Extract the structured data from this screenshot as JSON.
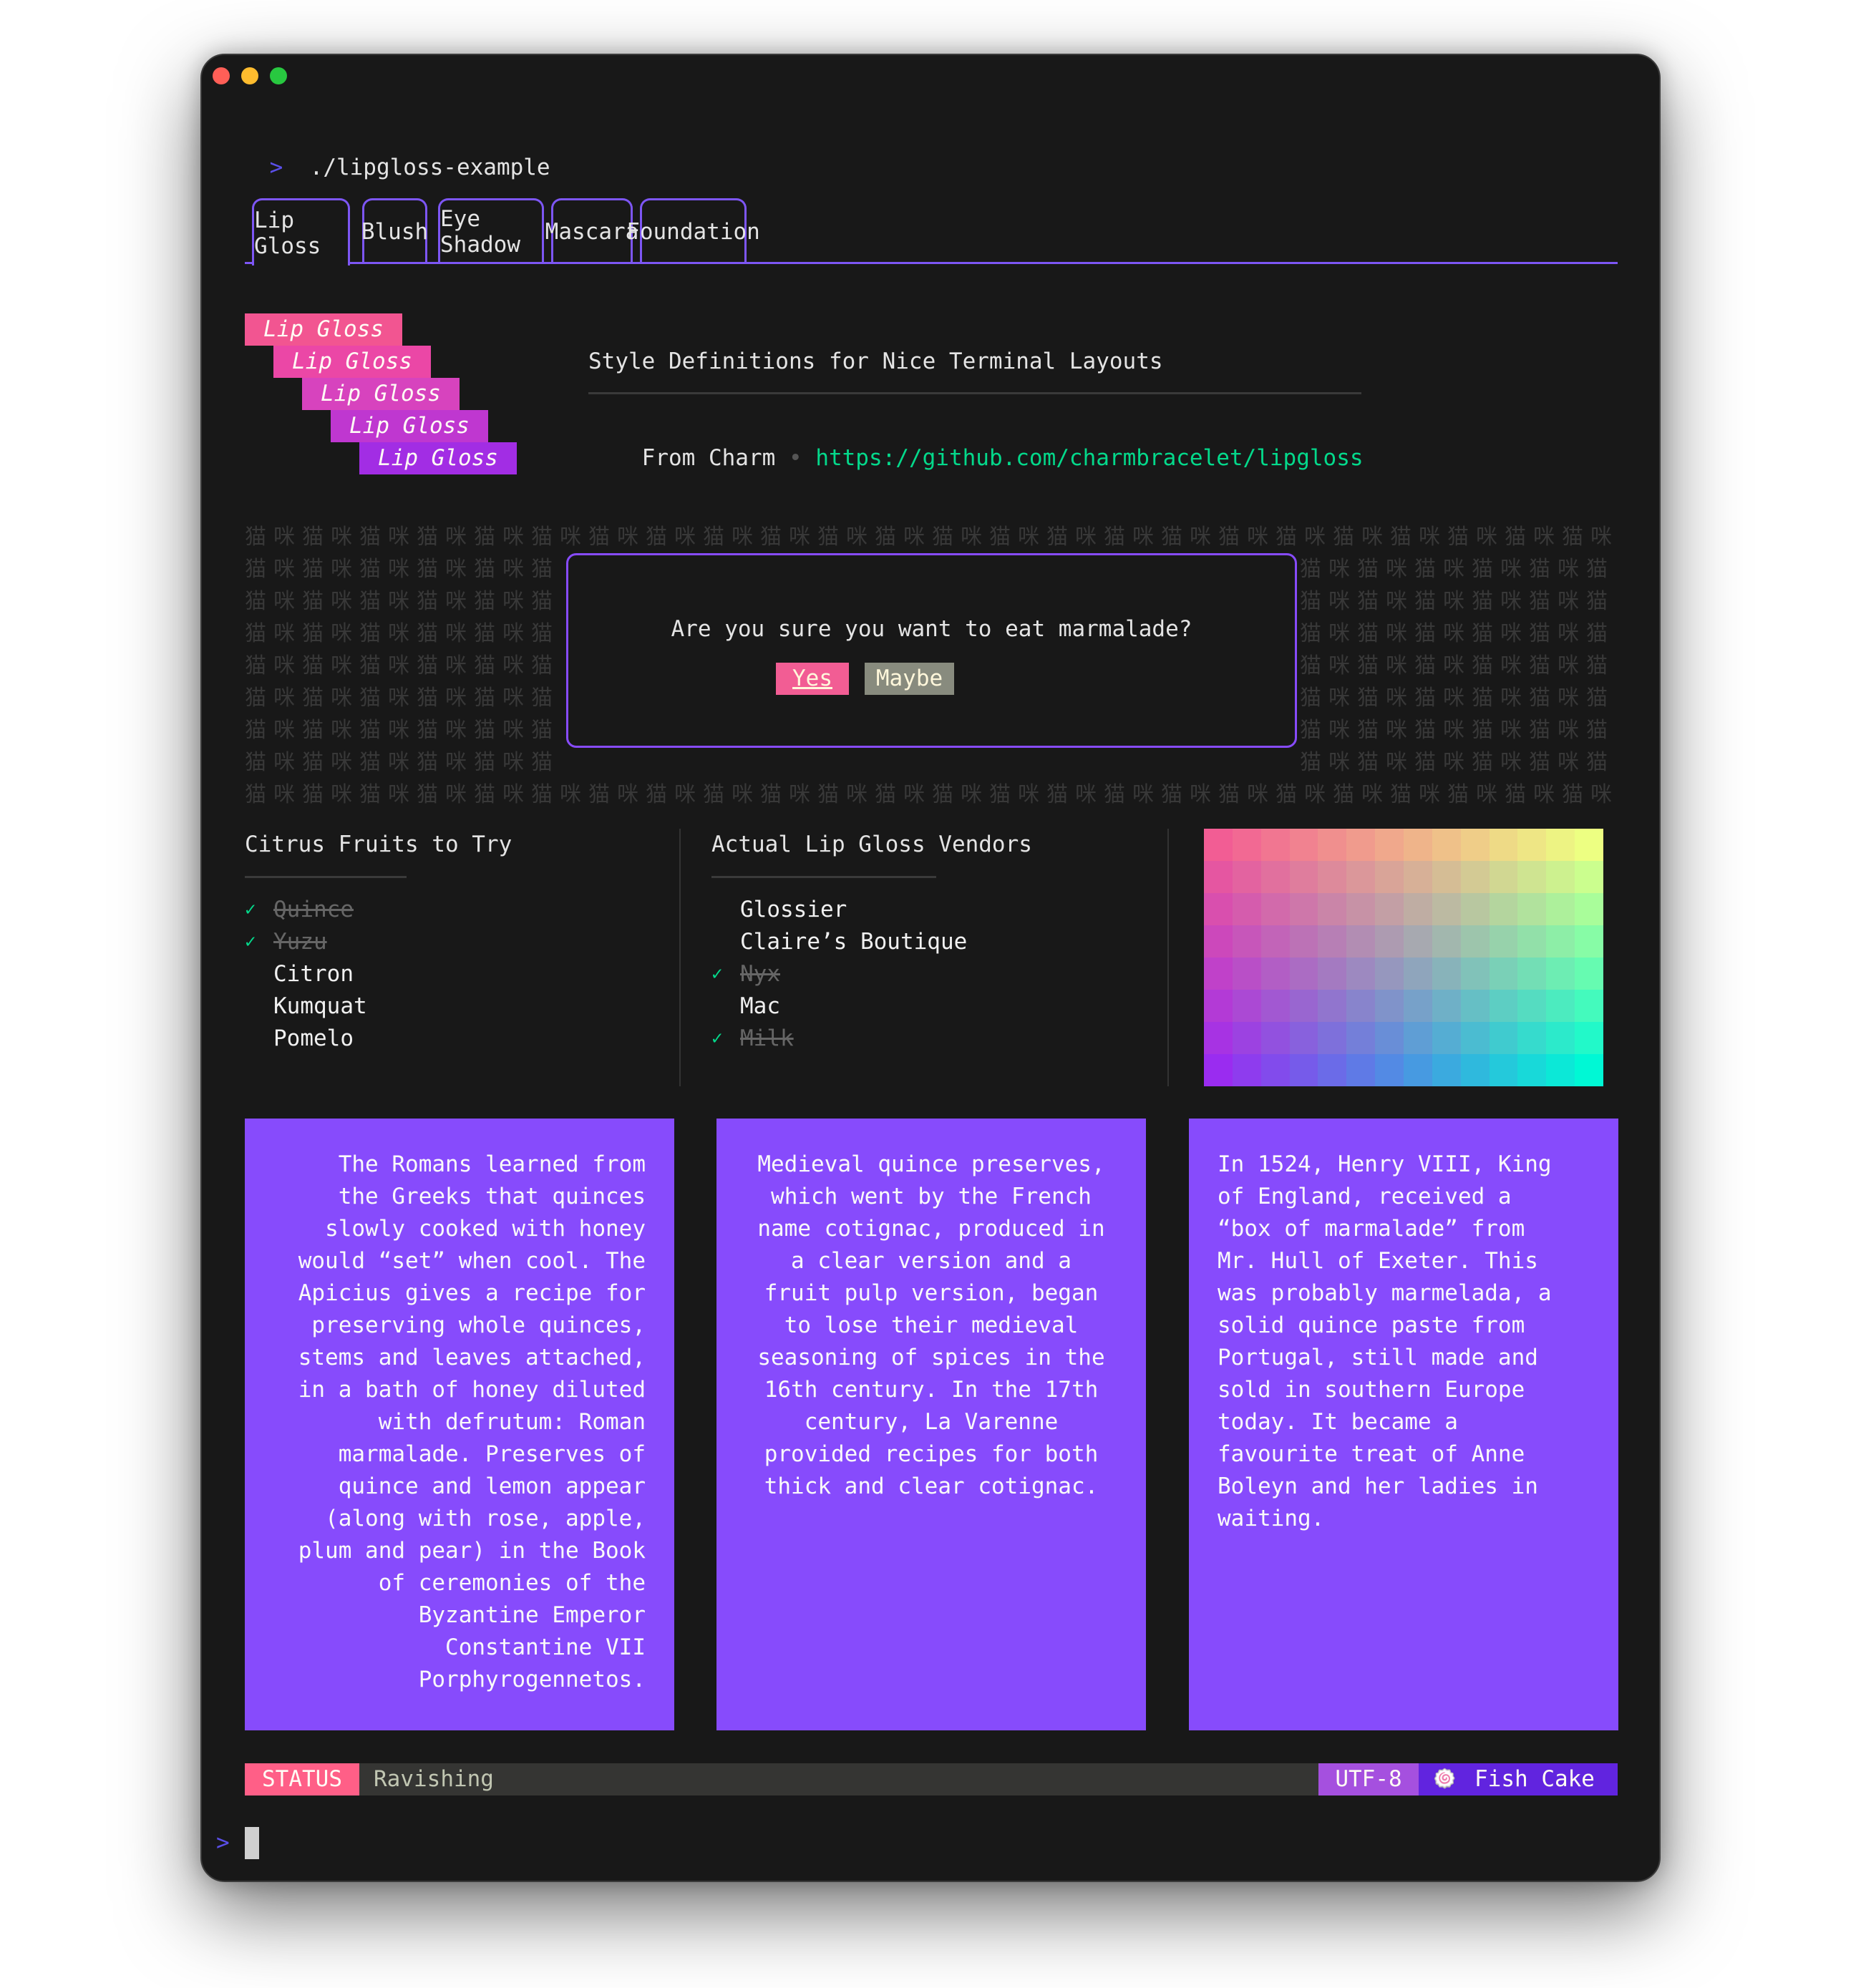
{
  "window": {
    "traffic_lights": [
      {
        "name": "close",
        "color": "#FF5F57"
      },
      {
        "name": "minimize",
        "color": "#FEBC2E"
      },
      {
        "name": "zoom",
        "color": "#28C840"
      }
    ]
  },
  "terminal": {
    "prompt_symbol": ">",
    "command": "./lipgloss-example"
  },
  "tabs": [
    {
      "label": "Lip Gloss",
      "active": true
    },
    {
      "label": "Blush",
      "active": false
    },
    {
      "label": "Eye Shadow",
      "active": false
    },
    {
      "label": "Mascara",
      "active": false
    },
    {
      "label": "Foundation",
      "active": false
    }
  ],
  "title_block": {
    "stack_label": "Lip Gloss",
    "stack_colors": [
      "#F25591",
      "#EB47A6",
      "#D743BE",
      "#BF37D0",
      "#A22DE4"
    ],
    "description": "Style Definitions for Nice Terminal Layouts",
    "from_label": "From Charm",
    "separator": "•",
    "url": "https://github.com/charmbracelet/lipgloss"
  },
  "background_pattern": {
    "chars": "猫咪"
  },
  "dialog": {
    "question": "Are you sure you want to eat marmalade?",
    "buttons": [
      {
        "label": "Yes",
        "active": true,
        "color": "#F25D94"
      },
      {
        "label": "Maybe",
        "active": false,
        "color": "#888B7E"
      }
    ]
  },
  "lists": [
    {
      "title": "Citrus Fruits to Try",
      "items": [
        {
          "label": "Quince",
          "done": true
        },
        {
          "label": "Yuzu",
          "done": true
        },
        {
          "label": "Citron",
          "done": false
        },
        {
          "label": "Kumquat",
          "done": false
        },
        {
          "label": "Pomelo",
          "done": false
        }
      ]
    },
    {
      "title": "Actual Lip Gloss Vendors",
      "items": [
        {
          "label": "Glossier",
          "done": false
        },
        {
          "label": "Claire’s Boutique",
          "done": false
        },
        {
          "label": "Nyx",
          "done": true
        },
        {
          "label": "Mac",
          "done": false
        },
        {
          "label": "Milk",
          "done": true
        }
      ]
    }
  ],
  "check_mark": "✓",
  "color_grid": {
    "columns": 14,
    "rows": 8,
    "corner_colors": {
      "top_left": "#F25D94",
      "top_right": "#EDFF82",
      "bottom_left": "#9A2CF0",
      "bottom_right": "#00F8D5"
    }
  },
  "paragraphs": [
    {
      "align": "right",
      "text": "The Romans learned from\nthe Greeks that quinces\nslowly cooked with honey\nwould “set” when cool. The\nApicius gives a recipe for\npreserving whole quinces,\nstems and leaves attached,\nin a bath of honey diluted\nwith defrutum: Roman\nmarmalade. Preserves of\nquince and lemon appear\n(along with rose, apple,\nplum and pear) in the Book\nof ceremonies of the\nByzantine Emperor\nConstantine VII\nPorphyrogennetos."
    },
    {
      "align": "center",
      "text": "Medieval quince preserves,\nwhich went by the French\nname cotignac, produced in\na clear version and a\nfruit pulp version, began\nto lose their medieval\nseasoning of spices in the\n16th century. In the 17th\ncentury, La Varenne\nprovided recipes for both\nthick and clear cotignac."
    },
    {
      "align": "left",
      "text": "In 1524, Henry VIII, King\nof England, received a\n“box of marmalade” from\nMr. Hull of Exeter. This\nwas probably marmelada, a\nsolid quince paste from\nPortugal, still made and\nsold in southern Europe\ntoday. It became a\nfavourite treat of Anne\nBoleyn and her ladies in\nwaiting."
    }
  ],
  "status_bar": {
    "status_label": "STATUS",
    "status_text": "Ravishing",
    "encoding": "UTF-8",
    "fish_cake_icon": "🍥",
    "fish_cake_label": "Fish Cake",
    "colors": {
      "status_bg": "#FF5F87",
      "encoding_bg": "#A550DF",
      "fish_bg": "#6124DF",
      "bar_bg": "#353533",
      "text": "#C1C6B2"
    }
  },
  "colors": {
    "highlight": "#874BFD",
    "special": "#04D98B",
    "subtle": "#383838"
  }
}
